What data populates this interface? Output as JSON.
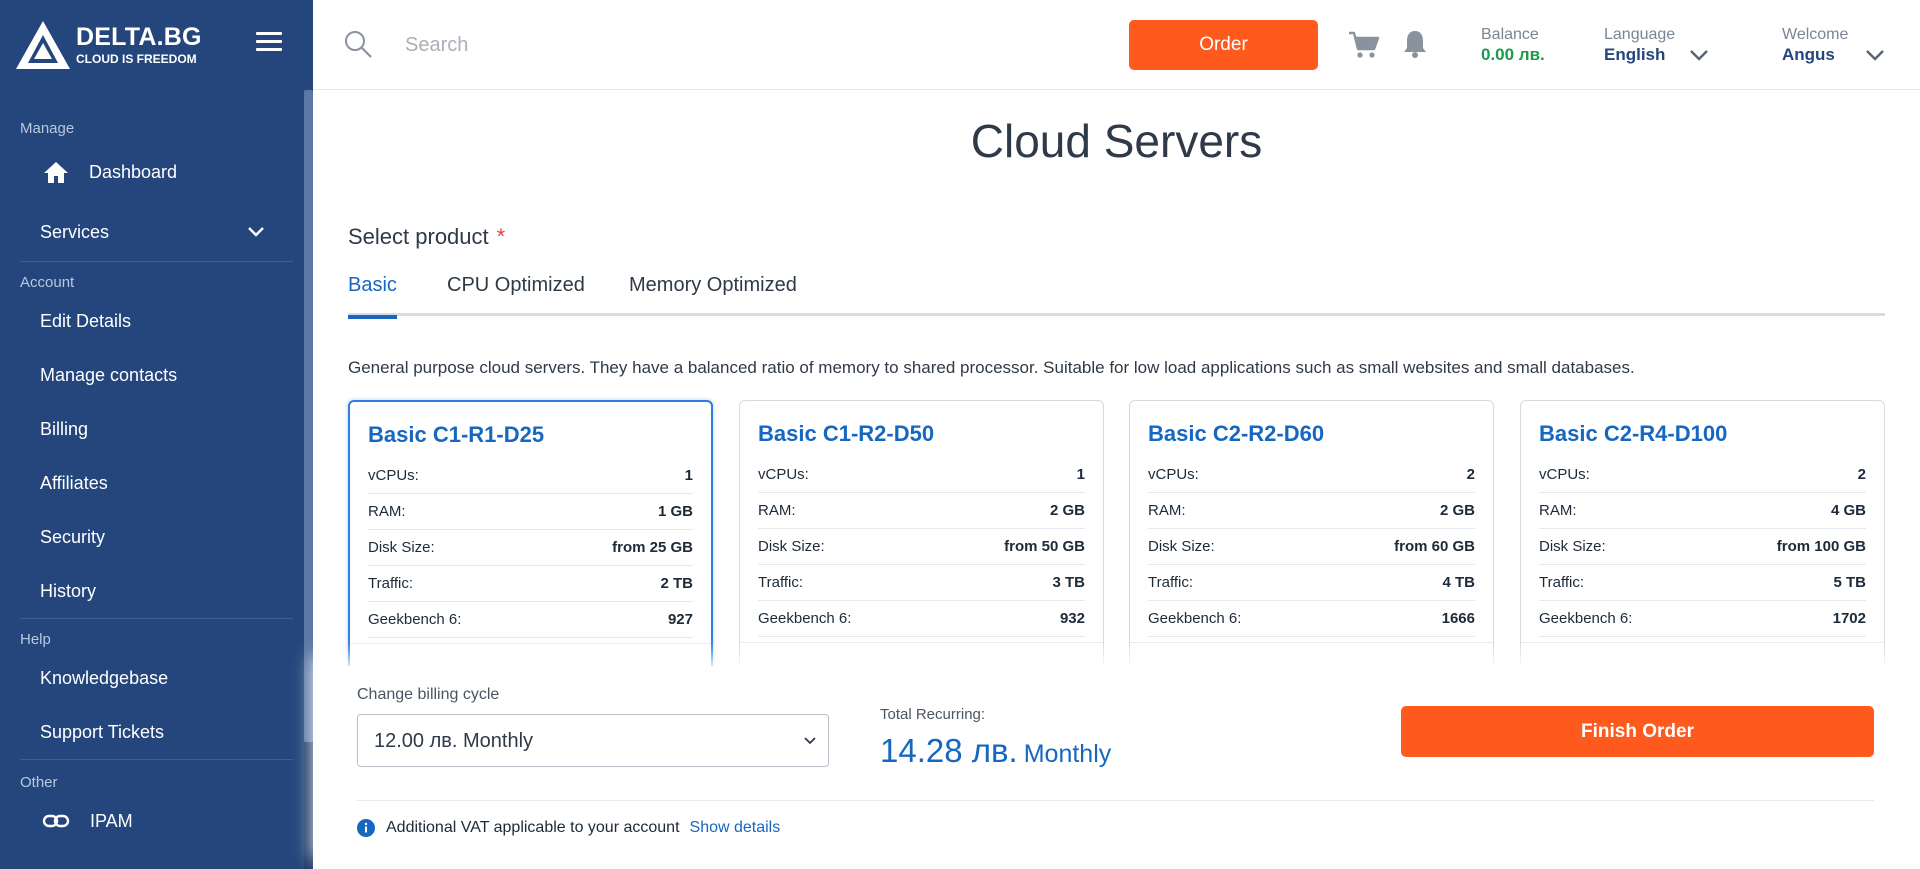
{
  "brand": {
    "name": "DELTA.BG",
    "tagline": "CLOUD IS FREEDOM"
  },
  "sidebar": {
    "sections": [
      {
        "title": "Manage",
        "items": [
          {
            "label": "Dashboard",
            "icon": "home-icon"
          },
          {
            "label": "Services",
            "icon": "chevron-down-icon"
          }
        ]
      },
      {
        "title": "Account",
        "items": [
          {
            "label": "Edit Details"
          },
          {
            "label": "Manage contacts"
          },
          {
            "label": "Billing"
          },
          {
            "label": "Affiliates"
          },
          {
            "label": "Security"
          },
          {
            "label": "History"
          }
        ]
      },
      {
        "title": "Help",
        "items": [
          {
            "label": "Knowledgebase"
          },
          {
            "label": "Support Tickets"
          }
        ]
      },
      {
        "title": "Other",
        "items": [
          {
            "label": "IPAM",
            "icon": "link-icon"
          }
        ]
      }
    ]
  },
  "topbar": {
    "search_placeholder": "Search",
    "order_label": "Order",
    "balance_label": "Balance",
    "balance_value": "0.00 лв.",
    "language_label": "Language",
    "language_value": "English",
    "welcome_label": "Welcome",
    "welcome_value": "Angus"
  },
  "main": {
    "title": "Cloud Servers",
    "select_product_label": "Select product",
    "required_mark": "*",
    "tabs": [
      {
        "label": "Basic",
        "active": true
      },
      {
        "label": "CPU Optimized",
        "active": false
      },
      {
        "label": "Memory Optimized",
        "active": false
      }
    ],
    "description": "General purpose cloud servers. They have a balanced ratio of memory to shared processor. Suitable for low load applications such as small websites and small databases.",
    "spec_labels": [
      "vCPUs:",
      "RAM:",
      "Disk Size:",
      "Traffic:",
      "Geekbench 6:"
    ],
    "products": [
      {
        "name": "Basic C1-R1-D25",
        "vcpus": "1",
        "ram": "1 GB",
        "disk": "from 25 GB",
        "traffic": "2 TB",
        "geekbench": "927",
        "selected": true
      },
      {
        "name": "Basic C1-R2-D50",
        "vcpus": "1",
        "ram": "2 GB",
        "disk": "from 50 GB",
        "traffic": "3 TB",
        "geekbench": "932",
        "selected": false
      },
      {
        "name": "Basic C2-R2-D60",
        "vcpus": "2",
        "ram": "2 GB",
        "disk": "from 60 GB",
        "traffic": "4 TB",
        "geekbench": "1666",
        "selected": false
      },
      {
        "name": "Basic C2-R4-D100",
        "vcpus": "2",
        "ram": "4 GB",
        "disk": "from 100 GB",
        "traffic": "5 TB",
        "geekbench": "1702",
        "selected": false
      }
    ]
  },
  "billing": {
    "change_cycle_label": "Change billing cycle",
    "selected_cycle": "12.00 лв. Monthly",
    "total_label": "Total Recurring:",
    "total_amount": "14.28 лв.",
    "total_cycle": "Monthly",
    "finish_label": "Finish Order",
    "vat_text": "Additional VAT applicable to your account",
    "show_details": "Show details"
  },
  "colors": {
    "sidebar": "#24467c",
    "accent": "#fe5a1d",
    "link": "#1667c0",
    "balance": "#1a9a4a"
  }
}
